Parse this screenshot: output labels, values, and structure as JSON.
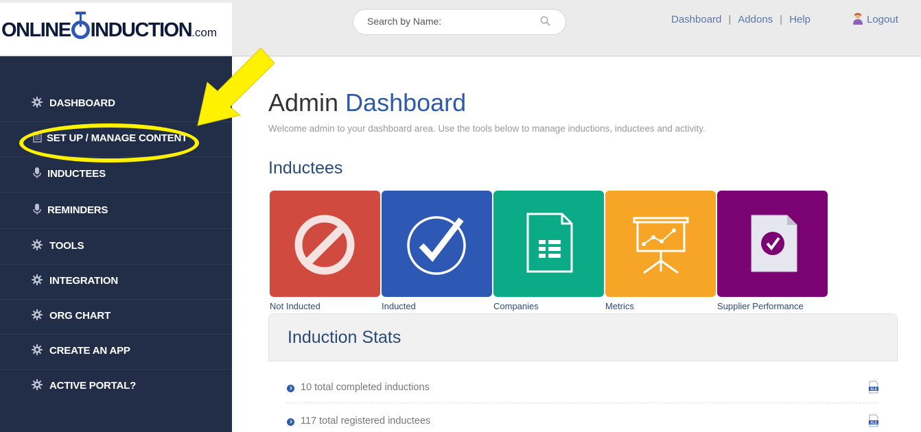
{
  "logo": {
    "part1": "ONLINE",
    "part2": "INDUCTION",
    "suffix": ".com"
  },
  "search": {
    "placeholder": "Search by Name:"
  },
  "topnav": {
    "dashboard": "Dashboard",
    "addons": "Addons",
    "help": "Help",
    "sep": "|",
    "logout": "Logout"
  },
  "sidebar": {
    "items": [
      {
        "label": "DASHBOARD",
        "icon": "gear-icon"
      },
      {
        "label": "SET UP / MANAGE CONTENT",
        "icon": "document-icon"
      },
      {
        "label": "INDUCTEES",
        "icon": "microphone-icon"
      },
      {
        "label": "REMINDERS",
        "icon": "microphone-icon"
      },
      {
        "label": "TOOLS",
        "icon": "gear-icon"
      },
      {
        "label": "INTEGRATION",
        "icon": "gear-icon"
      },
      {
        "label": "ORG CHART",
        "icon": "gear-icon"
      },
      {
        "label": "CREATE AN APP",
        "icon": "gear-icon"
      },
      {
        "label": "ACTIVE PORTAL?",
        "icon": "gear-icon"
      }
    ]
  },
  "main": {
    "title_plain": "Admin",
    "title_accent": "Dashboard",
    "welcome": "Welcome admin to your dashboard area. Use the tools below to manage inductions, inductees and activity.",
    "inductees_heading": "Inductees",
    "tiles": [
      {
        "label": "Not Inducted",
        "color": "#d14a3f",
        "icon": "prohibited-icon"
      },
      {
        "label": "Inducted",
        "color": "#2d59b4",
        "icon": "checkmark-circle-icon"
      },
      {
        "label": "Companies",
        "color": "#0aab86",
        "icon": "document-list-icon"
      },
      {
        "label": "Metrics",
        "color": "#f7a526",
        "icon": "presentation-chart-icon"
      },
      {
        "label": "Supplier Performance",
        "color": "#7b0273",
        "icon": "document-check-icon"
      }
    ],
    "stats_heading": "Induction Stats",
    "stats": [
      {
        "text": "10 total completed inductions",
        "icon": "xls-file-icon"
      },
      {
        "text": "117 total registered inductees",
        "icon": "xls-file-icon"
      }
    ]
  },
  "colors": {
    "sidebar_bg": "#222e48",
    "accent": "#2f5aa8",
    "highlight": "#fff200"
  }
}
